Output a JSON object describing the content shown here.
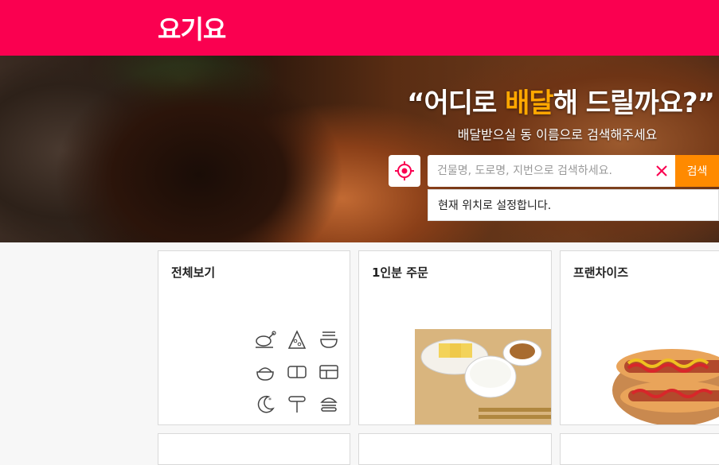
{
  "header": {
    "logo": "요기요",
    "brand_color": "#fa0050"
  },
  "hero": {
    "title_open": "“어디로 ",
    "title_highlight": "배달",
    "title_close": "해 드릴까요?”",
    "highlight_color": "#ffa800",
    "subtitle": "배달받으실 동 이름으로 검색해주세요"
  },
  "search": {
    "placeholder": "건물명, 도로명, 지번으로 검색하세요.",
    "value": "",
    "button_label": "검색",
    "button_color": "#ff8a00",
    "current_location_option": "현재 위치로 설정합니다."
  },
  "categories": [
    {
      "label": "전체보기",
      "icons": [
        "chicken-icon",
        "pizza-icon",
        "noodle-icon",
        "rice-bowl-icon",
        "sushi-icon",
        "lunchbox-icon",
        "night-food-icon",
        "bbq-skewer-icon",
        "burger-icon"
      ]
    },
    {
      "label": "1인분 주문"
    },
    {
      "label": "프랜차이즈"
    }
  ]
}
